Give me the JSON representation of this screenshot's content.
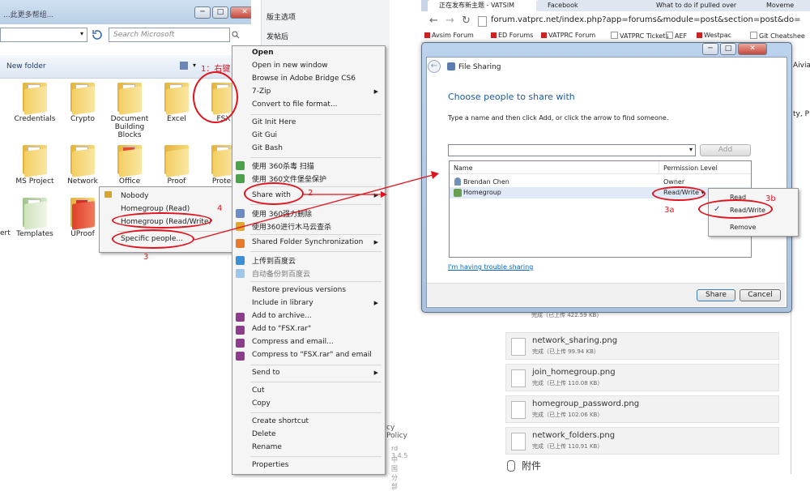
{
  "explorer": {
    "title_fragment": "...此更多帮组...",
    "search_placeholder": "Search Microsoft",
    "new_folder": "New folder",
    "folders": [
      {
        "label": "Credentials"
      },
      {
        "label": "Crypto"
      },
      {
        "label": "Document Building Blocks"
      },
      {
        "label": "Excel"
      },
      {
        "label": "FSX"
      },
      {
        "label": "MS Project"
      },
      {
        "label": "Network"
      },
      {
        "label": "Office"
      },
      {
        "label": "Proof"
      },
      {
        "label": "Protec"
      },
      {
        "label": "ert"
      },
      {
        "label": "Templates"
      },
      {
        "label": "UProof"
      }
    ],
    "window_buttons": {
      "minimize": "─",
      "maximize": "□",
      "close": "✕"
    }
  },
  "share_submenu": {
    "items": [
      "Nobody",
      "Homegroup (Read)",
      "Homegroup (Read/Write)",
      "Specific people..."
    ]
  },
  "context_menu": {
    "items": [
      "Open",
      "Open in new window",
      "Browse in Adobe Bridge CS6",
      "7-Zip",
      "Convert to file format...",
      "Git Init Here",
      "Git Gui",
      "Git Bash",
      "使用 360杀毒 扫描",
      "使用 360文件堡垒保护",
      "Share with",
      "使用 360强力删除",
      "使用360进行木马云查杀",
      "Shared Folder Synchronization",
      "上传到百度云",
      "自动备份到百度云",
      "Restore previous versions",
      "Include in library",
      "Add to archive...",
      "Add to \"FSX.rar\"",
      "Compress and email...",
      "Compress to \"FSX.rar\" and email",
      "Send to",
      "Cut",
      "Copy",
      "Create shortcut",
      "Delete",
      "Rename",
      "Properties"
    ]
  },
  "bg_page": {
    "items": [
      "版主选项",
      "发帖后"
    ],
    "bottom_text_1": "cy Policy",
    "bottom_text_2": "rd 3.4.5",
    "bottom_text_3": "中国分部"
  },
  "browser": {
    "tabs": [
      "正在发布新主题 - VATSIM",
      "Facebook",
      "What to do if pulled over",
      "Moveme"
    ],
    "url": "forum.vatprc.net/index.php?app=forums&module=post&section=post&do=",
    "bookmarks": [
      "Avsim Forum",
      "ED Forums",
      "VATPRC Forum",
      "VATPRC Tickets",
      "AEF",
      "Westpac",
      "Git Cheatshee"
    ],
    "right_text": [
      "Aivia",
      "ty, P"
    ]
  },
  "dialog": {
    "title": "File Sharing",
    "heading": "Choose people to share with",
    "instruction": "Type a name and then click Add, or click the arrow to find someone.",
    "add_button": "Add",
    "columns": [
      "Name",
      "Permission Level"
    ],
    "rows": [
      {
        "name": "Brendan Chen",
        "permission": "Owner"
      },
      {
        "name": "Homegroup",
        "permission": "Read/Write ▾"
      }
    ],
    "permission_menu": [
      "Read",
      "Read/Write",
      "Remove"
    ],
    "trouble_link": "I'm having trouble sharing",
    "share_button": "Share",
    "cancel_button": "Cancel",
    "window_buttons": {
      "minimize": "─",
      "maximize": "□",
      "close": "✕"
    }
  },
  "attachments": {
    "partial_top": "完成（已上传 422.59 KB）",
    "files": [
      {
        "name": "network_sharing.png",
        "status": "完成（已上传 99.94 KB）"
      },
      {
        "name": "join_homegroup.png",
        "status": "完成（已上传 110.08 KB）"
      },
      {
        "name": "homegroup_password.png",
        "status": "完成（已上传 102.06 KB）"
      },
      {
        "name": "network_folders.png",
        "status": "完成（已上传 110.91 KB）"
      }
    ],
    "section_title": "附件"
  },
  "annotations": {
    "a1": "1：右键",
    "a2": "2",
    "a3": "3",
    "a4": "4",
    "a3a": "3a",
    "a3b": "3b"
  },
  "colors": {
    "annotation_red": "#e1141e",
    "dialog_heading_blue": "#1a5aa6",
    "link_blue": "#0066cc"
  }
}
